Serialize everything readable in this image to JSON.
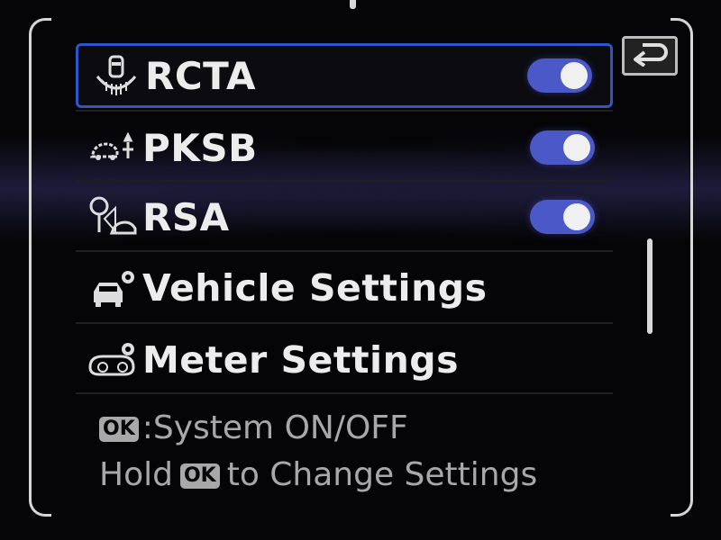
{
  "menu": {
    "items": [
      {
        "label": "RCTA",
        "icon": "rear-cross-traffic-icon",
        "toggle": "on",
        "selected": true
      },
      {
        "label": "PKSB",
        "icon": "parking-brake-assist-icon",
        "toggle": "on",
        "selected": false
      },
      {
        "label": "RSA",
        "icon": "road-sign-assist-icon",
        "toggle": "on",
        "selected": false
      },
      {
        "label": "Vehicle Settings",
        "icon": "vehicle-settings-icon"
      },
      {
        "label": "Meter Settings",
        "icon": "meter-settings-icon"
      }
    ]
  },
  "back": {
    "icon": "back-arrow-icon"
  },
  "footer": {
    "ok_badge": "OK",
    "line1_text": ":System ON/OFF",
    "line2_prefix": "Hold",
    "line2_suffix": "to Change Settings"
  },
  "colors": {
    "accent": "#2f56c9",
    "toggle_on": "#4b58c8",
    "text": "#ececec",
    "hint": "#a8a8a8"
  }
}
